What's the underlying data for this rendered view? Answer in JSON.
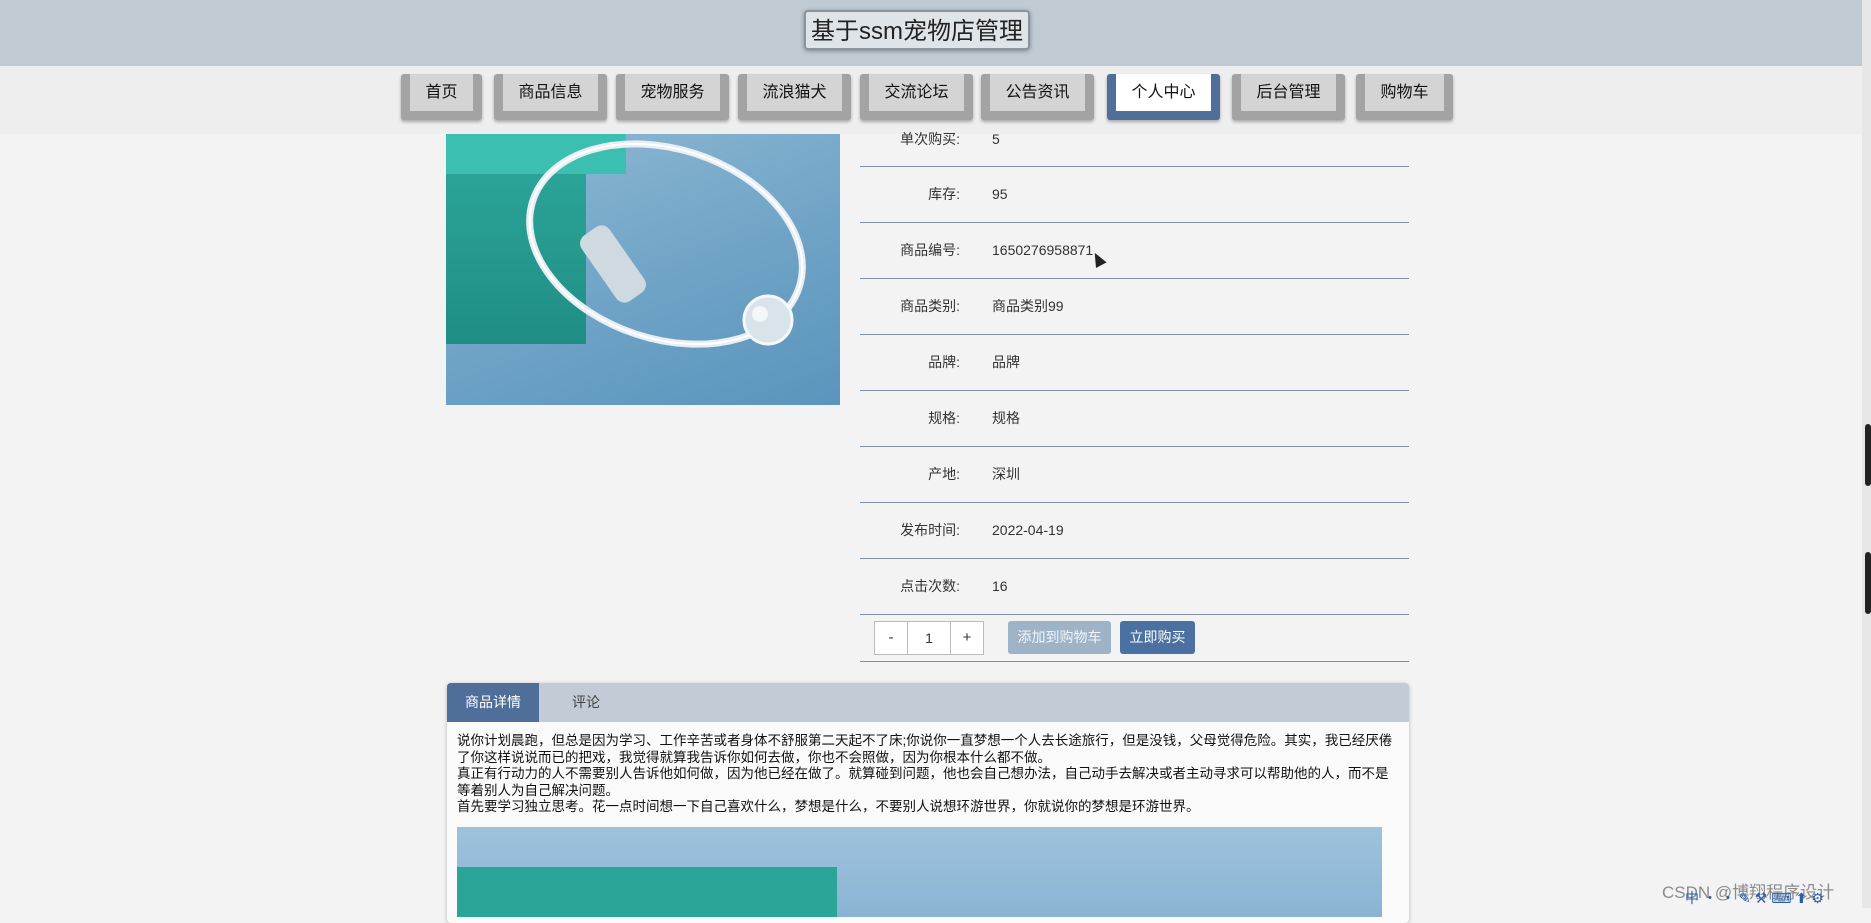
{
  "header": {
    "title": "基于ssm宠物店管理"
  },
  "nav": {
    "items": [
      {
        "label": "首页"
      },
      {
        "label": "商品信息"
      },
      {
        "label": "宠物服务"
      },
      {
        "label": "流浪猫犬"
      },
      {
        "label": "交流论坛"
      },
      {
        "label": "公告资讯"
      },
      {
        "label": "个人中心"
      },
      {
        "label": "后台管理"
      },
      {
        "label": "购物车"
      }
    ],
    "active": "个人中心"
  },
  "product": {
    "info": [
      {
        "label": "单次购买:",
        "value": "5"
      },
      {
        "label": "库存:",
        "value": "95"
      },
      {
        "label": "商品编号:",
        "value": "1650276958871"
      },
      {
        "label": "商品类别:",
        "value": "商品类别99"
      },
      {
        "label": "品牌:",
        "value": "品牌"
      },
      {
        "label": "规格:",
        "value": "规格"
      },
      {
        "label": "产地:",
        "value": "深圳"
      },
      {
        "label": "发布时间:",
        "value": "2022-04-19"
      },
      {
        "label": "点击次数:",
        "value": "16"
      }
    ],
    "quantity": {
      "minus": "-",
      "value": "1",
      "plus": "+"
    },
    "add_to_cart_label": "添加到购物车",
    "buy_now_label": "立即购买"
  },
  "tabs": {
    "items": [
      {
        "label": "商品详情"
      },
      {
        "label": "评论"
      }
    ],
    "active": "商品详情",
    "detail_paragraphs": [
      "说你计划晨跑，但总是因为学习、工作辛苦或者身体不舒服第二天起不了床;你说你一直梦想一个人去长途旅行，但是没钱，父母觉得危险。其实，我已经厌倦了你这样说说而已的把戏，我觉得就算我告诉你如何去做，你也不会照做，因为你根本什么都不做。",
      "真正有行动力的人不需要别人告诉他如何做，因为他已经在做了。就算碰到问题，他也会自己想办法，自己动手去解决或者主动寻求可以帮助他的人，而不是等着别人为自己解决问题。",
      "首先要学习独立思考。花一点时间想一下自己喜欢什么，梦想是什么，不要别人说想环游世界，你就说你的梦想是环游世界。"
    ]
  },
  "watermark": "CSDN @博翔程序设计",
  "tray_icons": "中・・✎⚒⌨⬆⚙",
  "colors": {
    "header_bg": "#bfcad3",
    "nav_active": "#4f6f9a",
    "buy_button": "#4b71a2",
    "cart_button": "#9fb3c8"
  }
}
